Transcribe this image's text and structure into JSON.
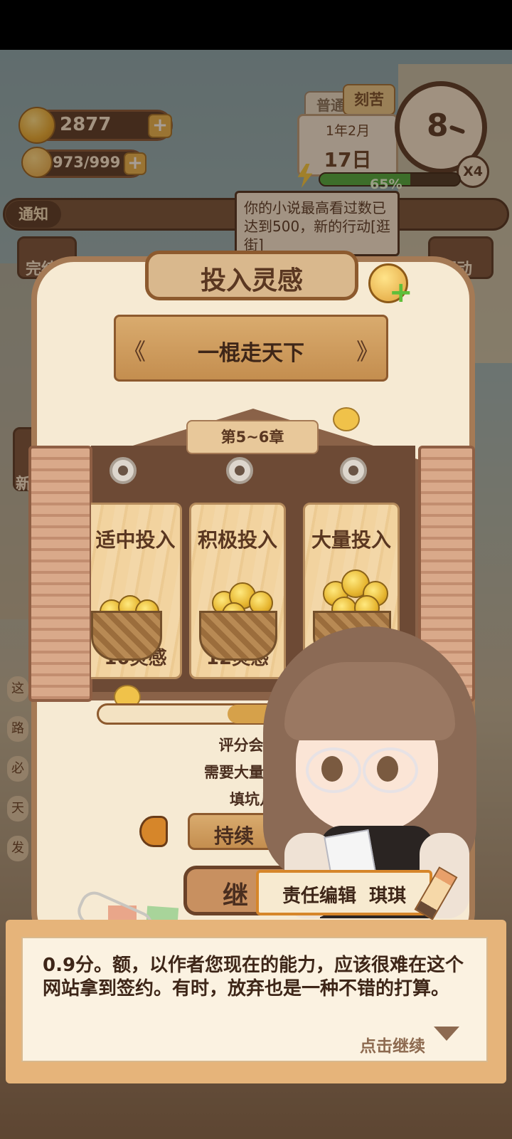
{
  "hud": {
    "coins": "2877",
    "inspiration": "973/999",
    "mode_normal": "普通",
    "mode_hard": "刻苦",
    "month": "1年2月",
    "day": "17日",
    "clock_value": "8",
    "speed_multiplier": "X4",
    "energy_percent_label": "65%",
    "energy_fraction": 0.65,
    "notice_label": "通知"
  },
  "tooltip": {
    "text": "你的小说最高看过数已达到500，新的行动[逛街]"
  },
  "side_menu": {
    "left_top": "完结",
    "left_mid": "新",
    "right_top": "行动",
    "left_letters": [
      "这",
      "路",
      "必",
      "天",
      "发"
    ]
  },
  "modal": {
    "title": "投入灵感",
    "novel_title": "一棍走天下",
    "prev_arrow": "《",
    "next_arrow": "》",
    "chapter": "第5~6章",
    "options": [
      {
        "label": "适中投入",
        "amount": "10灵感"
      },
      {
        "label": "积极投入",
        "amount": "12灵感"
      },
      {
        "label": "大量投入",
        "amount": ""
      }
    ],
    "desc_lines": [
      "评分会大幅",
      "需要大量的构",
      "填坑几率"
    ],
    "option_button": "持续",
    "continue_button": "继"
  },
  "dialog": {
    "speaker": "责任编辑  琪琪",
    "text": "0.9分。额，以作者您现在的能力，应该很难在这个网站拿到签约。有时，放弃也是一种不错的打算。",
    "continue_hint": "点击继续"
  },
  "colors": {
    "wood_dark": "#4a2e1f",
    "panel_cream": "#f6ead3",
    "text_brown": "#5a3721",
    "energy_green": "#3fa83a"
  }
}
